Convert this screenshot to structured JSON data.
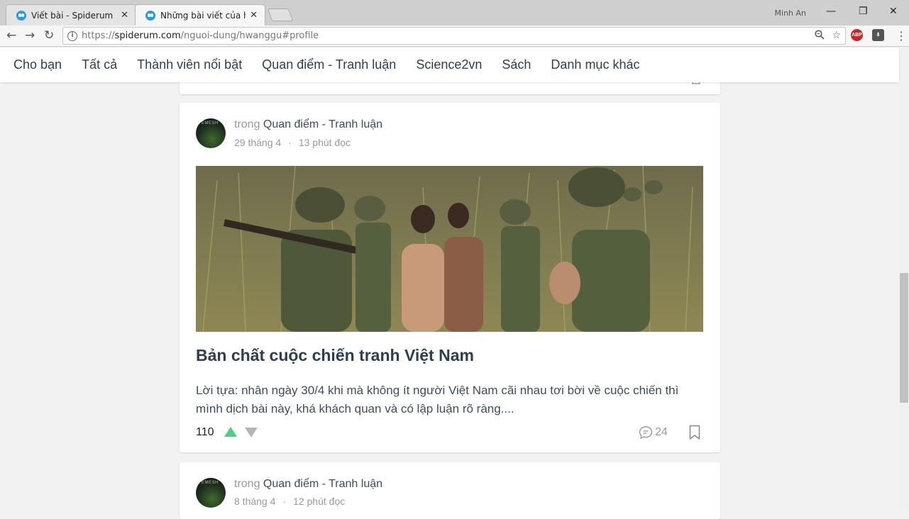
{
  "browser": {
    "tabs": [
      {
        "title": "Viết bài - Spiderum",
        "close": "✕"
      },
      {
        "title": "Những bài viết của hwanggu",
        "close": "✕"
      }
    ],
    "user": "Minh An",
    "url": {
      "scheme": "https://",
      "host": "spiderum.com",
      "path": "/nguoi-dung/hwanggu#profile"
    },
    "extensions": {
      "abp": "ABP"
    }
  },
  "site_nav": {
    "items": [
      "Cho bạn",
      "Tất cả",
      "Thành viên nổi bật",
      "Quan điểm - Tranh luận",
      "Science2vn",
      "Sách",
      "Danh mục khác"
    ]
  },
  "posts": [
    {
      "prefix": "trong",
      "category": "Quan điểm - Tranh luận",
      "date": "29 tháng 4",
      "read_time": "13 phút đọc",
      "title": "Bản chất cuộc chiến tranh Việt Nam",
      "excerpt": "Lời tựa: nhân ngày 30/4 khi mà không ít người Việt Nam cãi nhau tơi bời về cuộc chiến thì mình dịch bài này, khá khách quan và có lập luận rõ ràng....",
      "votes": "110",
      "comments": "24"
    },
    {
      "prefix": "trong",
      "category": "Quan điểm - Tranh luận",
      "date": "8 tháng 4",
      "read_time": "12 phút đọc"
    }
  ],
  "separator": "·",
  "colors": {
    "upvote": "#4cd07d",
    "downvote": "#b5b5b5",
    "title": "#2d3e50",
    "meta": "#999999"
  }
}
